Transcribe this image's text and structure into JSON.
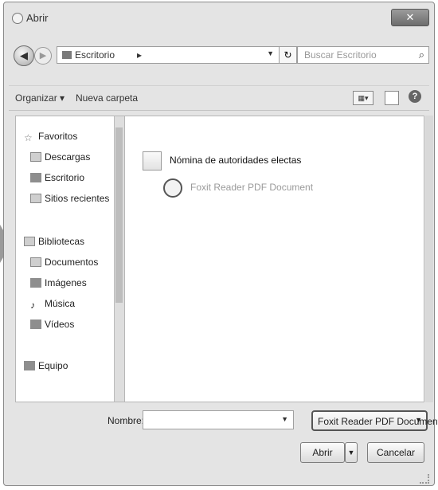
{
  "window": {
    "title": "Abrir",
    "close_label": "✕"
  },
  "navbar": {
    "back_glyph": "◀",
    "forward_glyph": "▶",
    "address_path": "Escritorio",
    "address_separator": "▸",
    "refresh_glyph": "↻",
    "search_placeholder": "Buscar Escritorio",
    "search_glyph": "⌕"
  },
  "toolbar": {
    "organize_label": "Organizar ▾",
    "new_folder_label": "Nueva carpeta",
    "help_label": "?"
  },
  "sidebar": {
    "items": [
      {
        "label": "Favoritos",
        "icon": "star-icon"
      },
      {
        "label": "Descargas",
        "icon": "download-folder-icon"
      },
      {
        "label": "Escritorio",
        "icon": "desktop-icon"
      },
      {
        "label": "Sitios recientes",
        "icon": "recent-places-icon"
      },
      {
        "label": "Bibliotecas",
        "icon": "library-icon"
      },
      {
        "label": "Documentos",
        "icon": "documents-icon"
      },
      {
        "label": "Imágenes",
        "icon": "pictures-icon"
      },
      {
        "label": "Música",
        "icon": "music-icon"
      },
      {
        "label": "Vídeos",
        "icon": "videos-icon"
      },
      {
        "label": "Equipo",
        "icon": "computer-icon"
      }
    ]
  },
  "files": [
    {
      "name": "Nómina de autoridades electas",
      "type": "Foxit Reader PDF Document"
    }
  ],
  "footer": {
    "filename_label": "Nombre:",
    "filename_value": "",
    "filetype_value": "Foxit Reader PDF Document",
    "open_label": "Abrir",
    "cancel_label": "Cancelar"
  },
  "colors": {
    "dialog_bg": "#e4e4e4",
    "pane_bg": "#ffffff",
    "border": "#b6b6b6"
  }
}
